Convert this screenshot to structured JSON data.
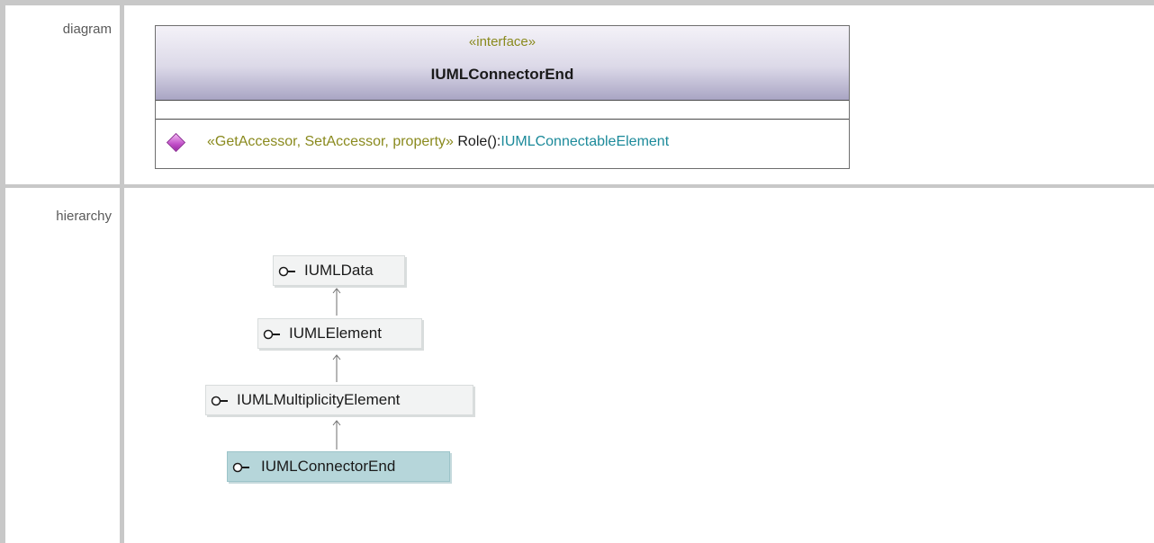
{
  "rows": {
    "diagram_label": "diagram",
    "hierarchy_label": "hierarchy"
  },
  "interface_box": {
    "stereotype": "«interface»",
    "name": "IUMLConnectorEnd",
    "operation": {
      "icon": "diamond-operation-icon",
      "stereotypes": "«GetAccessor, SetAccessor, property»",
      "name": "Role():",
      "return_type": "IUMLConnectableElement"
    }
  },
  "hierarchy": {
    "nodes": [
      {
        "label": "IUMLData",
        "icon": "interface-lollipop-icon"
      },
      {
        "label": "IUMLElement",
        "icon": "interface-lollipop-icon"
      },
      {
        "label": "IUMLMultiplicityElement",
        "icon": "interface-lollipop-icon"
      },
      {
        "label": "IUMLConnectorEnd",
        "icon": "interface-lollipop-icon",
        "current": true
      }
    ]
  },
  "colors": {
    "stereotype": "#8a8a1e",
    "type_ref": "#1c8a9a",
    "operation_icon": "#c14fc8",
    "current_node": "#b6d6da",
    "node": "#f2f3f3",
    "grid": "#c8c8c8"
  }
}
